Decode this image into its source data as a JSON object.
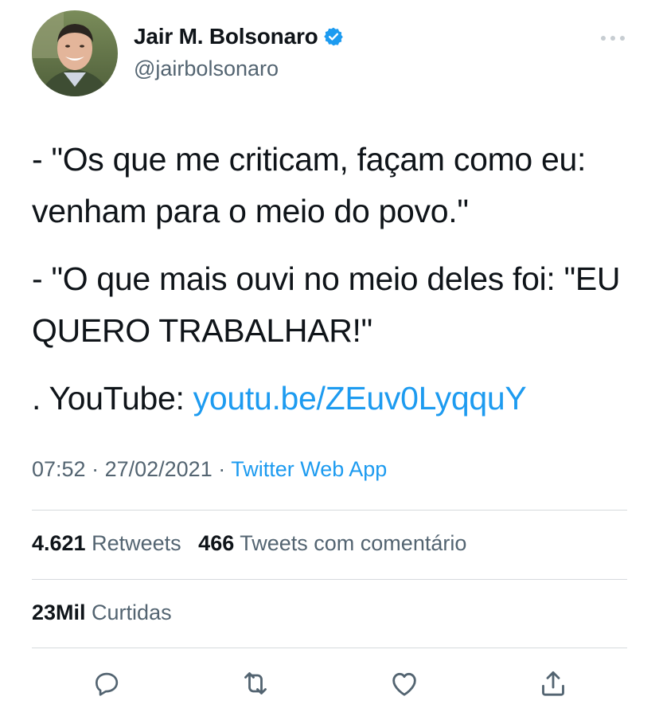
{
  "header": {
    "display_name": "Jair M. Bolsonaro",
    "handle": "@jairbolsonaro",
    "verified_icon": "verified-badge-icon",
    "more_icon": "more-icon"
  },
  "tweet": {
    "para1": "- \"Os que me criticam, façam como eu: venham para o meio do povo.\"",
    "para2": "- \"O que mais ouvi no meio deles foi: \"EU QUERO TRABALHAR!\"",
    "para3_prefix": ". YouTube: ",
    "para3_link": "youtu.be/ZEuv0LyqquY"
  },
  "meta": {
    "time": "07:52",
    "separator": " · ",
    "date": "27/02/2021",
    "source": "Twitter Web App"
  },
  "stats": {
    "retweets_count": "4.621",
    "retweets_label": "Retweets",
    "quotes_count": "466",
    "quotes_label": "Tweets com comentário",
    "likes_count": "23Mil",
    "likes_label": "Curtidas"
  },
  "actions": {
    "reply_icon": "reply-icon",
    "retweet_icon": "retweet-icon",
    "like_icon": "like-icon",
    "share_icon": "share-icon"
  },
  "colors": {
    "link": "#1d9bf0",
    "secondary_text": "#536471",
    "primary_text": "#0f1419",
    "divider": "#d6dadd"
  }
}
